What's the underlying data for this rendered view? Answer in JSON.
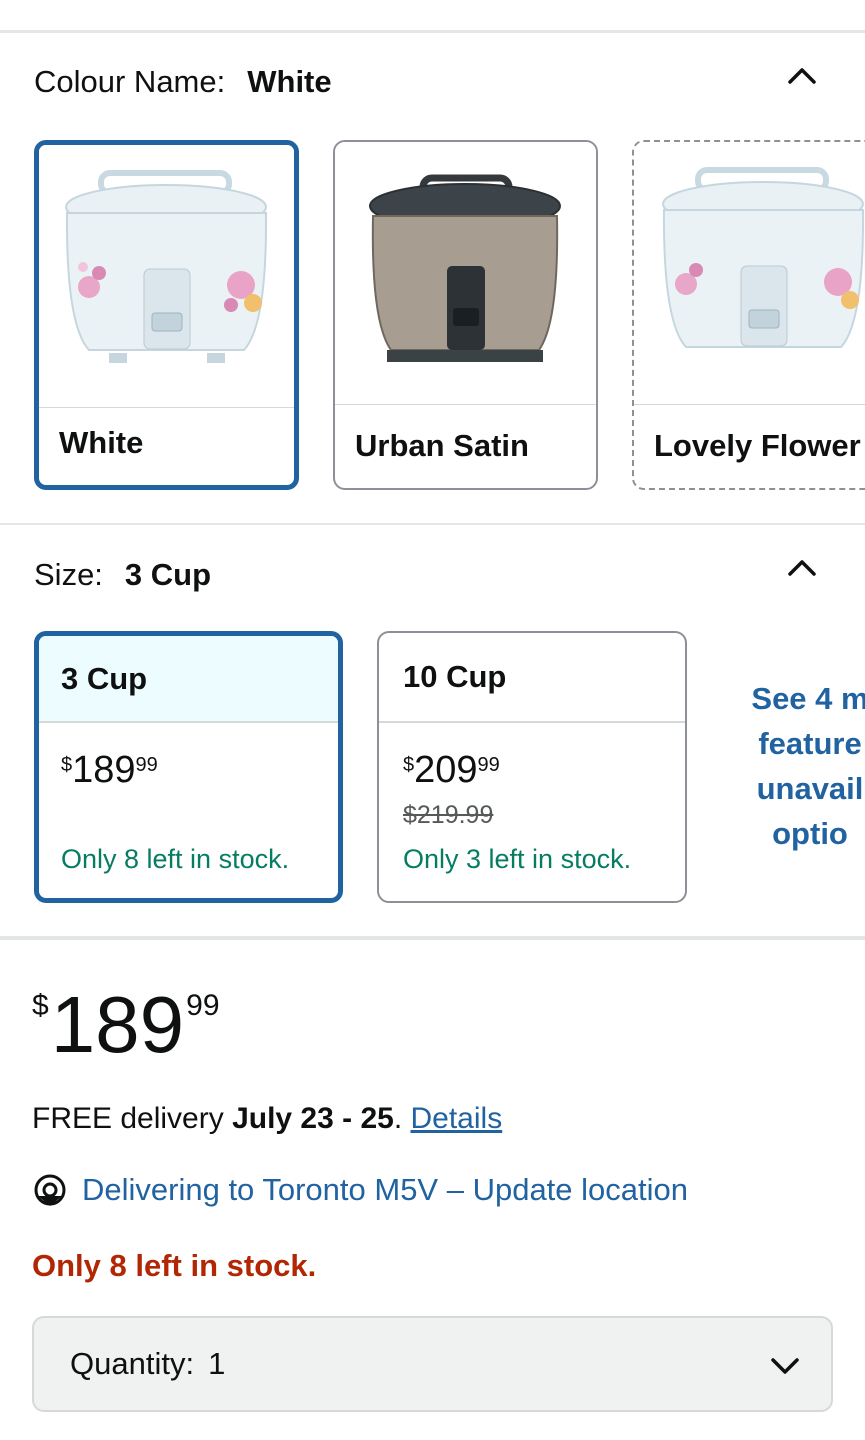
{
  "colour": {
    "label": "Colour Name:",
    "selected": "White",
    "options": [
      {
        "name": "White",
        "state": "selected"
      },
      {
        "name": "Urban Satin",
        "state": "available"
      },
      {
        "name": "Lovely Flower",
        "state": "unavailable"
      }
    ]
  },
  "size": {
    "label": "Size:",
    "selected": "3 Cup",
    "options": [
      {
        "name": "3 Cup",
        "price_currency": "$",
        "price_whole": "189",
        "price_fraction": "99",
        "list_price": "",
        "stock": "Only 8 left in stock."
      },
      {
        "name": "10 Cup",
        "price_currency": "$",
        "price_whole": "209",
        "price_fraction": "99",
        "list_price": "$219.99",
        "stock": "Only 3 left in stock."
      }
    ],
    "see_more_lines": [
      "See 4 m",
      "feature",
      "unavail",
      "optio"
    ]
  },
  "price": {
    "currency": "$",
    "whole": "189",
    "fraction": "99"
  },
  "delivery": {
    "prefix": "FREE delivery ",
    "dates": "July 23 - 25",
    "suffix": ". ",
    "link": "Details"
  },
  "location": {
    "text": "Delivering to Toronto M5V – Update location",
    "icon": "location-pin-icon"
  },
  "stock_message": "Only 8 left in stock.",
  "quantity": {
    "label": "Quantity:",
    "value": "1",
    "icon": "chevron-down-icon"
  },
  "colors": {
    "accent_blue": "#2162a1",
    "stock_green": "#067d62",
    "alert_red": "#b12704"
  }
}
